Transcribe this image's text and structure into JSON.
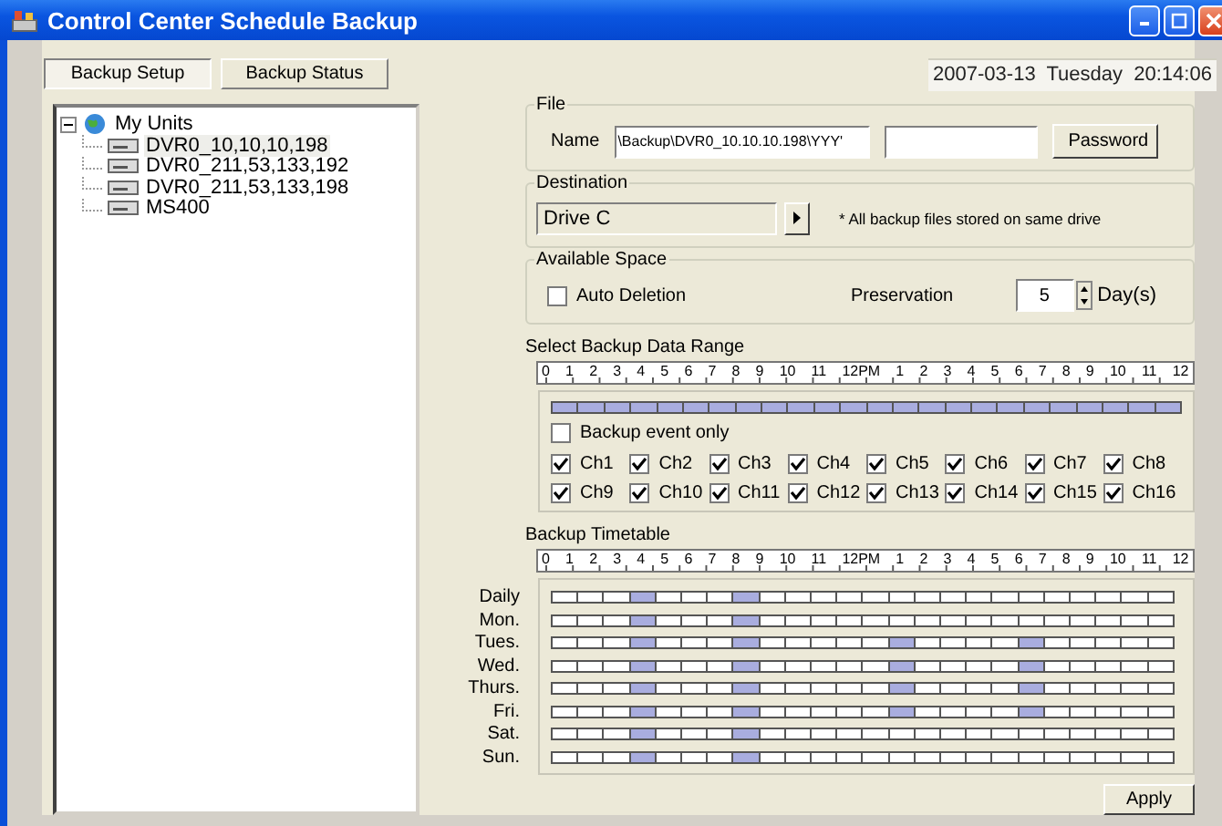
{
  "window": {
    "title": "Control Center Schedule Backup"
  },
  "tabs": [
    {
      "label": "Backup Setup",
      "selected": true
    },
    {
      "label": "Backup Status",
      "selected": false
    }
  ],
  "datetime": "2007-03-13  Tuesday  20:14:06",
  "tree": {
    "label": "My Units",
    "expanded": true,
    "children": [
      {
        "label": "DVR0_10,10,10,198",
        "selected": true
      },
      {
        "label": "DVR0_211,53,133,192",
        "selected": false
      },
      {
        "label": "DVR0_211,53,133,198",
        "selected": false
      },
      {
        "label": "MS400",
        "selected": false
      }
    ]
  },
  "file": {
    "legend": "File",
    "name_label": "Name",
    "path": "\\Backup\\DVR0_10.10.10.198\\YYY'",
    "password_button": "Password"
  },
  "destination": {
    "legend": "Destination",
    "drive": "Drive C",
    "note": "* All backup files stored on same drive"
  },
  "available_space": {
    "legend": "Available Space",
    "auto_deletion": {
      "label": "Auto Deletion",
      "checked": false
    },
    "preservation_label": "Preservation",
    "preservation_value": "5",
    "unit": "Day(s)"
  },
  "data_range": {
    "title": "Select Backup Data Range",
    "ruler": [
      "0",
      "1",
      "2",
      "3",
      "4",
      "5",
      "6",
      "7",
      "8",
      "9",
      "10",
      "11",
      "12PM",
      "1",
      "2",
      "3",
      "4",
      "5",
      "6",
      "7",
      "8",
      "9",
      "10",
      "11",
      "12"
    ],
    "hours": [
      true,
      true,
      true,
      true,
      true,
      true,
      true,
      true,
      true,
      true,
      true,
      true,
      true,
      true,
      true,
      true,
      true,
      true,
      true,
      true,
      true,
      true,
      true,
      true
    ],
    "event_only": {
      "label": "Backup event only",
      "checked": false
    },
    "channels": [
      {
        "label": "Ch1",
        "checked": true
      },
      {
        "label": "Ch2",
        "checked": true
      },
      {
        "label": "Ch3",
        "checked": true
      },
      {
        "label": "Ch4",
        "checked": true
      },
      {
        "label": "Ch5",
        "checked": true
      },
      {
        "label": "Ch6",
        "checked": true
      },
      {
        "label": "Ch7",
        "checked": true
      },
      {
        "label": "Ch8",
        "checked": true
      },
      {
        "label": "Ch9",
        "checked": true
      },
      {
        "label": "Ch10",
        "checked": true
      },
      {
        "label": "Ch11",
        "checked": true
      },
      {
        "label": "Ch12",
        "checked": true
      },
      {
        "label": "Ch13",
        "checked": true
      },
      {
        "label": "Ch14",
        "checked": true
      },
      {
        "label": "Ch15",
        "checked": true
      },
      {
        "label": "Ch16",
        "checked": true
      }
    ]
  },
  "timetable": {
    "title": "Backup Timetable",
    "ruler": [
      "0",
      "1",
      "2",
      "3",
      "4",
      "5",
      "6",
      "7",
      "8",
      "9",
      "10",
      "11",
      "12PM",
      "1",
      "2",
      "3",
      "4",
      "5",
      "6",
      "7",
      "8",
      "9",
      "10",
      "11",
      "12"
    ],
    "rows": [
      {
        "label": "Daily",
        "hours": [
          false,
          false,
          false,
          true,
          false,
          false,
          false,
          true,
          false,
          false,
          false,
          false,
          false,
          false,
          false,
          false,
          false,
          false,
          false,
          false,
          false,
          false,
          false,
          false
        ]
      },
      {
        "label": "Mon.",
        "hours": [
          false,
          false,
          false,
          true,
          false,
          false,
          false,
          true,
          false,
          false,
          false,
          false,
          false,
          false,
          false,
          false,
          false,
          false,
          false,
          false,
          false,
          false,
          false,
          false
        ]
      },
      {
        "label": "Tues.",
        "hours": [
          false,
          false,
          false,
          true,
          false,
          false,
          false,
          true,
          false,
          false,
          false,
          false,
          false,
          true,
          false,
          false,
          false,
          false,
          true,
          false,
          false,
          false,
          false,
          false
        ]
      },
      {
        "label": "Wed.",
        "hours": [
          false,
          false,
          false,
          true,
          false,
          false,
          false,
          true,
          false,
          false,
          false,
          false,
          false,
          true,
          false,
          false,
          false,
          false,
          true,
          false,
          false,
          false,
          false,
          false
        ]
      },
      {
        "label": "Thurs.",
        "hours": [
          false,
          false,
          false,
          true,
          false,
          false,
          false,
          true,
          false,
          false,
          false,
          false,
          false,
          true,
          false,
          false,
          false,
          false,
          true,
          false,
          false,
          false,
          false,
          false
        ]
      },
      {
        "label": "Fri.",
        "hours": [
          false,
          false,
          false,
          true,
          false,
          false,
          false,
          true,
          false,
          false,
          false,
          false,
          false,
          true,
          false,
          false,
          false,
          false,
          true,
          false,
          false,
          false,
          false,
          false
        ]
      },
      {
        "label": "Sat.",
        "hours": [
          false,
          false,
          false,
          true,
          false,
          false,
          false,
          true,
          false,
          false,
          false,
          false,
          false,
          false,
          false,
          false,
          false,
          false,
          false,
          false,
          false,
          false,
          false,
          false
        ]
      },
      {
        "label": "Sun.",
        "hours": [
          false,
          false,
          false,
          true,
          false,
          false,
          false,
          true,
          false,
          false,
          false,
          false,
          false,
          false,
          false,
          false,
          false,
          false,
          false,
          false,
          false,
          false,
          false,
          false
        ]
      }
    ]
  },
  "apply_button": "Apply"
}
